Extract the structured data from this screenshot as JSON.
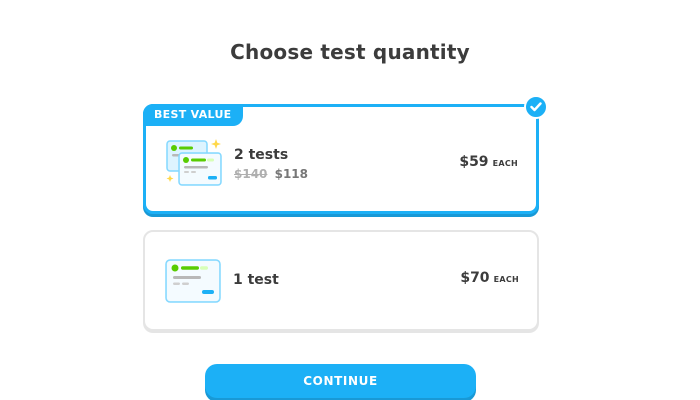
{
  "title": "Choose test quantity",
  "options": [
    {
      "badge": "BEST VALUE",
      "name": "2 tests",
      "original_price": "$140",
      "total_price": "$118",
      "unit_price": "$59",
      "unit_suffix": "EACH",
      "selected": true
    },
    {
      "name": "1 test",
      "unit_price": "$70",
      "unit_suffix": "EACH",
      "selected": false
    }
  ],
  "continue_label": "CONTINUE",
  "colors": {
    "accent": "#1cb0f6",
    "accent_shadow": "#1899d6",
    "text": "#3c3c3c",
    "muted": "#afafaf",
    "border": "#e5e5e5",
    "icon_green": "#58cc02"
  },
  "icons": [
    "checkmark-icon",
    "test-certificates-icon",
    "test-certificate-icon"
  ]
}
